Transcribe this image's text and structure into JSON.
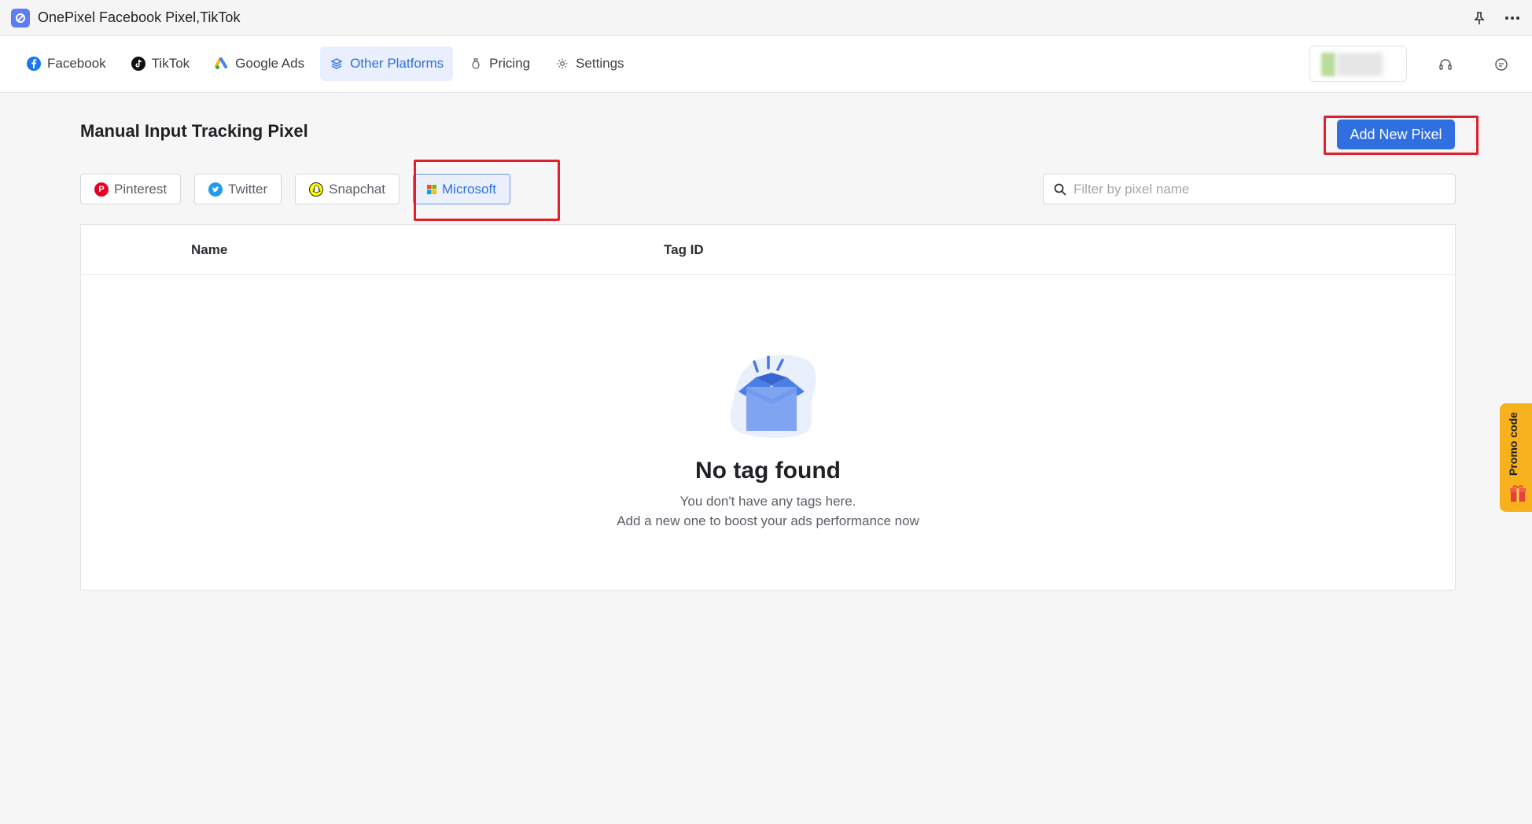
{
  "window": {
    "title": "OnePixel Facebook Pixel,TikTok"
  },
  "nav": {
    "items": [
      {
        "label": "Facebook",
        "icon": "facebook-icon",
        "active": false
      },
      {
        "label": "TikTok",
        "icon": "tiktok-icon",
        "active": false
      },
      {
        "label": "Google Ads",
        "icon": "google-ads-icon",
        "active": false
      },
      {
        "label": "Other Platforms",
        "icon": "layers-icon",
        "active": true
      },
      {
        "label": "Pricing",
        "icon": "money-bag-icon",
        "active": false
      },
      {
        "label": "Settings",
        "icon": "gear-icon",
        "active": false
      }
    ]
  },
  "main": {
    "title": "Manual Input Tracking Pixel",
    "add_button": "Add New Pixel",
    "tabs": [
      {
        "label": "Pinterest",
        "icon": "pinterest-icon",
        "color": "#e60023",
        "active": false
      },
      {
        "label": "Twitter",
        "icon": "twitter-icon",
        "color": "#1d9bf0",
        "active": false
      },
      {
        "label": "Snapchat",
        "icon": "snapchat-icon",
        "color": "#fffc00",
        "active": false
      },
      {
        "label": "Microsoft",
        "icon": "microsoft-icon",
        "color": "#2f6fe0",
        "active": true
      }
    ],
    "search": {
      "placeholder": "Filter by pixel name",
      "value": ""
    },
    "table": {
      "columns": [
        "Name",
        "Tag ID"
      ],
      "rows": []
    },
    "empty": {
      "title": "No tag found",
      "line1": "You don't have any tags here.",
      "line2": "Add a new one to boost your ads performance now"
    }
  },
  "promo": {
    "label": "Promo code"
  },
  "colors": {
    "accent": "#2f6fe0",
    "highlight": "#e0202a",
    "promo": "#f7b11c"
  }
}
